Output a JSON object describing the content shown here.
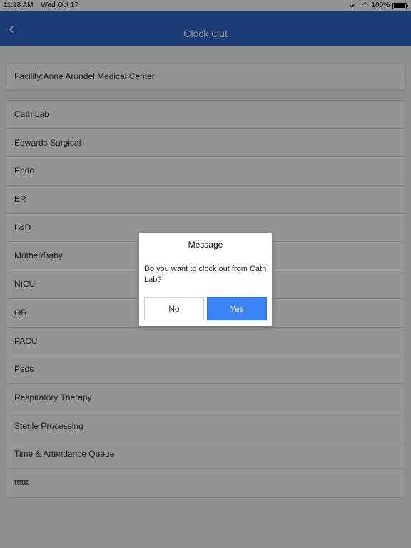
{
  "status_bar": {
    "time": "11:18 AM",
    "date": "Wed Oct 17",
    "battery": "100%",
    "icons": [
      "lock-rotation-icon",
      "wifi-icon",
      "battery-icon"
    ]
  },
  "nav": {
    "title": "Clock Out",
    "back_icon": "chevron-left-icon",
    "color": "#2e67c8"
  },
  "facility": "Facility:Anne Arundel Medical Center",
  "departments": [
    "Cath Lab",
    "Edwards Surgical",
    "Endo",
    "ER",
    "L&D",
    "Mother/Baby",
    "NICU",
    "OR",
    "PACU",
    "Peds",
    "Respiratory Therapy",
    "Sterile Processing",
    "Time & Attendance Queue",
    "tttttt"
  ],
  "dialog": {
    "title": "Message",
    "message": "Do you want to clock out from Cath Lab?",
    "no_label": "No",
    "yes_label": "Yes",
    "yes_color": "#3c83f5"
  }
}
